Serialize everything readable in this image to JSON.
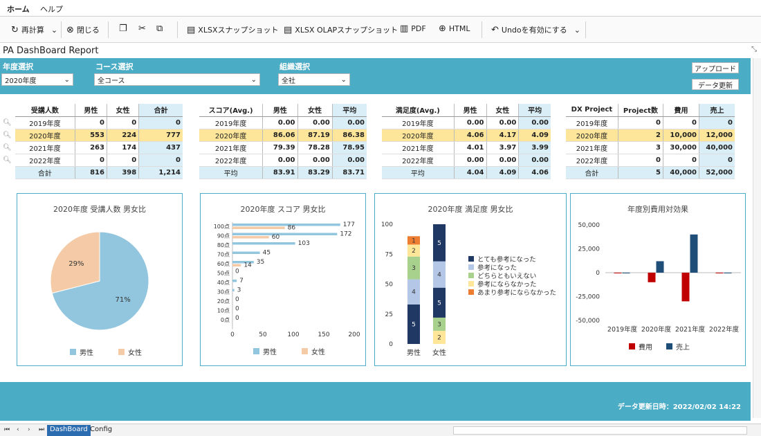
{
  "menu": {
    "tab_home": "ホーム",
    "tab_help": "ヘルプ"
  },
  "toolbar": {
    "recalc": "再計算",
    "close": "閉じる",
    "xlsx_snap": "XLSXスナップショット",
    "olap_snap": "XLSX OLAPスナップショット",
    "pdf": "PDF",
    "html": "HTML",
    "undo": "Undoを有効にする"
  },
  "report_title": "PA DashBoard Report",
  "filters": {
    "year_label": "年度選択",
    "year_value": "2020年度",
    "course_label": "コース選択",
    "course_value": "全コース",
    "org_label": "組織選択",
    "org_value": "全社",
    "upload_btn": "アップロード",
    "refresh_btn": "データ更新"
  },
  "table1": {
    "headers": [
      "受講人数",
      "男性",
      "女性",
      "合計"
    ],
    "rows": [
      [
        "2019年度",
        "0",
        "0",
        "0"
      ],
      [
        "2020年度",
        "553",
        "224",
        "777"
      ],
      [
        "2021年度",
        "263",
        "174",
        "437"
      ],
      [
        "2022年度",
        "0",
        "0",
        "0"
      ],
      [
        "合計",
        "816",
        "398",
        "1,214"
      ]
    ]
  },
  "table2": {
    "headers": [
      "スコア(Avg.)",
      "男性",
      "女性",
      "平均"
    ],
    "rows": [
      [
        "2019年度",
        "0.00",
        "0.00",
        "0.00"
      ],
      [
        "2020年度",
        "86.06",
        "87.19",
        "86.38"
      ],
      [
        "2021年度",
        "79.39",
        "78.28",
        "78.95"
      ],
      [
        "2022年度",
        "0.00",
        "0.00",
        "0.00"
      ],
      [
        "平均",
        "83.91",
        "83.29",
        "83.71"
      ]
    ]
  },
  "table3": {
    "headers": [
      "満足度(Avg.)",
      "男性",
      "女性",
      "平均"
    ],
    "rows": [
      [
        "2019年度",
        "0.00",
        "0.00",
        "0.00"
      ],
      [
        "2020年度",
        "4.06",
        "4.17",
        "4.09"
      ],
      [
        "2021年度",
        "4.01",
        "3.97",
        "3.99"
      ],
      [
        "2022年度",
        "0.00",
        "0.00",
        "0.00"
      ],
      [
        "平均",
        "4.04",
        "4.09",
        "4.06"
      ]
    ]
  },
  "table4": {
    "headers": [
      "DX Project",
      "Project数",
      "費用",
      "売上"
    ],
    "rows": [
      [
        "2019年度",
        "0",
        "0",
        "0"
      ],
      [
        "2020年度",
        "2",
        "10,000",
        "12,000"
      ],
      [
        "2021年度",
        "3",
        "30,000",
        "40,000"
      ],
      [
        "2022年度",
        "0",
        "0",
        "0"
      ],
      [
        "合計",
        "5",
        "40,000",
        "52,000"
      ]
    ]
  },
  "chart_data": [
    {
      "type": "pie",
      "title": "2020年度 受講人数 男女比",
      "slices": [
        {
          "name": "男性",
          "value": 71,
          "label": "71%",
          "color": "#92c5de"
        },
        {
          "name": "女性",
          "value": 29,
          "label": "29%",
          "color": "#f4cba6"
        }
      ]
    },
    {
      "type": "bar",
      "orientation": "horizontal",
      "title": "2020年度 スコア 男女比",
      "categories": [
        "100点",
        "90点",
        "80点",
        "70点",
        "60点",
        "50点",
        "40点",
        "30点",
        "20点",
        "10点",
        "0点"
      ],
      "series": [
        {
          "name": "男性",
          "color": "#92c5de",
          "values": [
            177,
            172,
            103,
            45,
            35,
            0,
            7,
            3,
            0,
            0,
            0
          ]
        },
        {
          "name": "女性",
          "color": "#f4cba6",
          "values": [
            86,
            60,
            0,
            0,
            14,
            0,
            0,
            0,
            0,
            0,
            0
          ]
        }
      ],
      "xlim": [
        0,
        200
      ],
      "xticks": [
        "0",
        "50",
        "100",
        "150",
        "200"
      ]
    },
    {
      "type": "bar",
      "stacked": true,
      "title": "2020年度 満足度 男女比",
      "categories": [
        "男性",
        "女性"
      ],
      "ylim": [
        0,
        100
      ],
      "yticks": [
        "0",
        "25",
        "50",
        "75",
        "100"
      ],
      "series": [
        {
          "name": "あまり参考にならなかった",
          "level": "1",
          "color": "#ed7d31",
          "values": [
            33,
            2
          ]
        },
        {
          "name": "参考にならなかった",
          "level": "2",
          "color": "#ffe699",
          "values": [
            0,
            3
          ]
        },
        {
          "name": "どちらともいえない",
          "level": "3",
          "color": "#a9d18e",
          "values": [
            0,
            0
          ]
        },
        {
          "name": "参考になった",
          "level": "4",
          "color": "#b4c7e7",
          "values": [
            0,
            0
          ]
        },
        {
          "name": "とても参考になった",
          "level": "5",
          "color": "#203864",
          "values": [
            0,
            0
          ]
        }
      ],
      "segments": [
        [
          {
            "level": "5",
            "value": 33
          },
          {
            "level": "4",
            "value": 21
          },
          {
            "level": "3",
            "value": 19
          },
          {
            "level": "2",
            "value": 10
          },
          {
            "level": "1",
            "value": 7
          }
        ],
        [
          {
            "level": "2",
            "value": 11
          },
          {
            "level": "3",
            "value": 11
          },
          {
            "level": "5",
            "value": 25
          },
          {
            "level": "4",
            "value": 22
          },
          {
            "level": "5",
            "value": 31
          }
        ]
      ]
    },
    {
      "type": "bar",
      "title": "年度別費用対効果",
      "categories": [
        "2019年度",
        "2020年度",
        "2021年度",
        "2022年度"
      ],
      "series": [
        {
          "name": "費用",
          "color": "#c00000",
          "values": [
            0,
            -10000,
            -30000,
            0
          ]
        },
        {
          "name": "売上",
          "color": "#1f4e79",
          "values": [
            0,
            12000,
            40000,
            0
          ]
        }
      ],
      "ylim": [
        -50000,
        50000
      ],
      "yticks": [
        "50,000",
        "25,000",
        "0",
        "-25,000",
        "-50,000"
      ]
    }
  ],
  "footer": {
    "updated": "データ更新日時：2022/02/02 14:22"
  },
  "sheets": {
    "active": "DashBoard",
    "other": "Config"
  }
}
